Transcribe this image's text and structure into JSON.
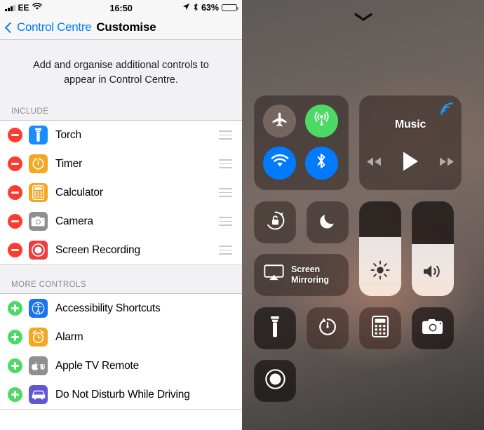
{
  "status_bar": {
    "carrier": "EE",
    "signal_icon": "signal-bars-icon",
    "wifi_icon": "wifi-icon",
    "time": "16:50",
    "location_icon": "location-arrow-icon",
    "bluetooth_icon": "bluetooth-icon",
    "battery_percent": "63%",
    "battery_icon": "battery-icon",
    "battery_level": 63
  },
  "nav_bar": {
    "back_icon": "chevron-left-icon",
    "back_label": "Control Centre",
    "title": "Customise"
  },
  "intro_text": "Add and organise additional controls to appear in Control Centre.",
  "sections": [
    {
      "header": "INCLUDE",
      "action": "remove",
      "action_icon": "minus-circle-icon",
      "action_color": "#ff3b30",
      "has_handle": true,
      "items": [
        {
          "label": "Torch",
          "icon": "torch-icon",
          "icon_bg": "#1a8cff"
        },
        {
          "label": "Timer",
          "icon": "timer-icon",
          "icon_bg": "#f5a623"
        },
        {
          "label": "Calculator",
          "icon": "calculator-icon",
          "icon_bg": "#f5a623"
        },
        {
          "label": "Camera",
          "icon": "camera-icon",
          "icon_bg": "#8e8e93"
        },
        {
          "label": "Screen Recording",
          "icon": "screen-recording-icon",
          "icon_bg": "#ef3d3d"
        }
      ]
    },
    {
      "header": "MORE CONTROLS",
      "action": "add",
      "action_icon": "plus-circle-icon",
      "action_color": "#4cd964",
      "has_handle": false,
      "items": [
        {
          "label": "Accessibility Shortcuts",
          "icon": "accessibility-icon",
          "icon_bg": "#1a72f0"
        },
        {
          "label": "Alarm",
          "icon": "alarm-clock-icon",
          "icon_bg": "#f5a623"
        },
        {
          "label": "Apple TV Remote",
          "icon": "apple-tv-icon",
          "icon_bg": "#8e8e93"
        },
        {
          "label": "Do Not Disturb While Driving",
          "icon": "car-icon",
          "icon_bg": "#6257d2"
        }
      ]
    }
  ],
  "control_centre": {
    "grabber_icon": "chevron-down-icon",
    "connectivity": {
      "toggles": [
        {
          "name": "airplane-mode",
          "icon": "airplane-icon",
          "state": "off",
          "color": "#756760"
        },
        {
          "name": "cellular-data",
          "icon": "cellular-antenna-icon",
          "state": "on",
          "color": "#4cd964"
        },
        {
          "name": "wifi",
          "icon": "wifi-icon",
          "state": "on",
          "color": "#007aff"
        },
        {
          "name": "bluetooth",
          "icon": "bluetooth-icon",
          "state": "on",
          "color": "#007aff"
        }
      ]
    },
    "music": {
      "title": "Music",
      "airplay_icon": "airplay-audio-icon",
      "previous_icon": "rewind-icon",
      "play_icon": "play-icon",
      "next_icon": "fast-forward-icon"
    },
    "rotation_lock": {
      "label": "",
      "icon": "rotation-lock-icon"
    },
    "do_not_disturb": {
      "label": "",
      "icon": "moon-icon"
    },
    "screen_mirroring": {
      "label_line1": "Screen",
      "label_line2": "Mirroring",
      "icon": "airplay-screen-icon"
    },
    "brightness_slider": {
      "icon": "brightness-sun-icon",
      "value": 62
    },
    "volume_slider": {
      "icon": "speaker-icon",
      "value": 55
    },
    "shortcuts": [
      {
        "name": "torch",
        "icon": "torch-icon"
      },
      {
        "name": "timer",
        "icon": "timer-icon"
      },
      {
        "name": "calculator",
        "icon": "calculator-icon"
      },
      {
        "name": "camera",
        "icon": "camera-icon"
      },
      {
        "name": "screen-recording",
        "icon": "screen-recording-icon"
      }
    ]
  }
}
